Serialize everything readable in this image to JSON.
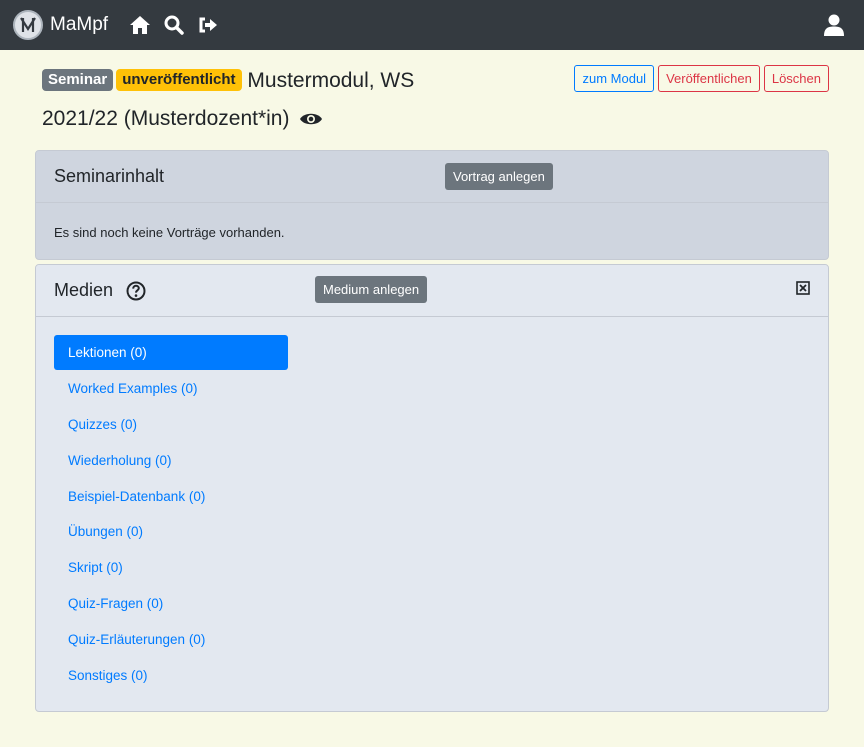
{
  "navbar": {
    "brand_name": "MaMpf",
    "icons": [
      "home-icon",
      "search-icon",
      "logout-icon",
      "user-icon"
    ]
  },
  "title": {
    "badge_type": "Seminar",
    "badge_status": "unveröffentlicht",
    "text": "Mustermodul, WS 2021/22 (Musterdozent*in)"
  },
  "actions": {
    "module_label": "zum Modul",
    "publish_label": "Veröffentlichen",
    "delete_label": "Löschen"
  },
  "seminar": {
    "title": "Seminarinhalt",
    "add_label": "Vortrag anlegen",
    "empty_text": "Es sind noch keine Vorträge vorhanden."
  },
  "media": {
    "title": "Medien",
    "add_label": "Medium anlegen",
    "items": [
      {
        "label": "Lektionen (0)",
        "active": true
      },
      {
        "label": "Worked Examples (0)"
      },
      {
        "label": "Quizzes (0)"
      },
      {
        "label": "Wiederholung (0)"
      },
      {
        "label": "Beispiel-Datenbank (0)"
      },
      {
        "label": "Übungen (0)"
      },
      {
        "label": "Skript (0)"
      },
      {
        "label": "Quiz-Fragen (0)"
      },
      {
        "label": "Quiz-Erläuterungen (0)"
      },
      {
        "label": "Sonstiges (0)"
      }
    ]
  },
  "colors": {
    "navbar": "#343a40",
    "page_bg": "#f8f9e6",
    "primary": "#007bff",
    "danger": "#dc3545",
    "warning": "#ffc107",
    "secondary": "#6c757d"
  }
}
